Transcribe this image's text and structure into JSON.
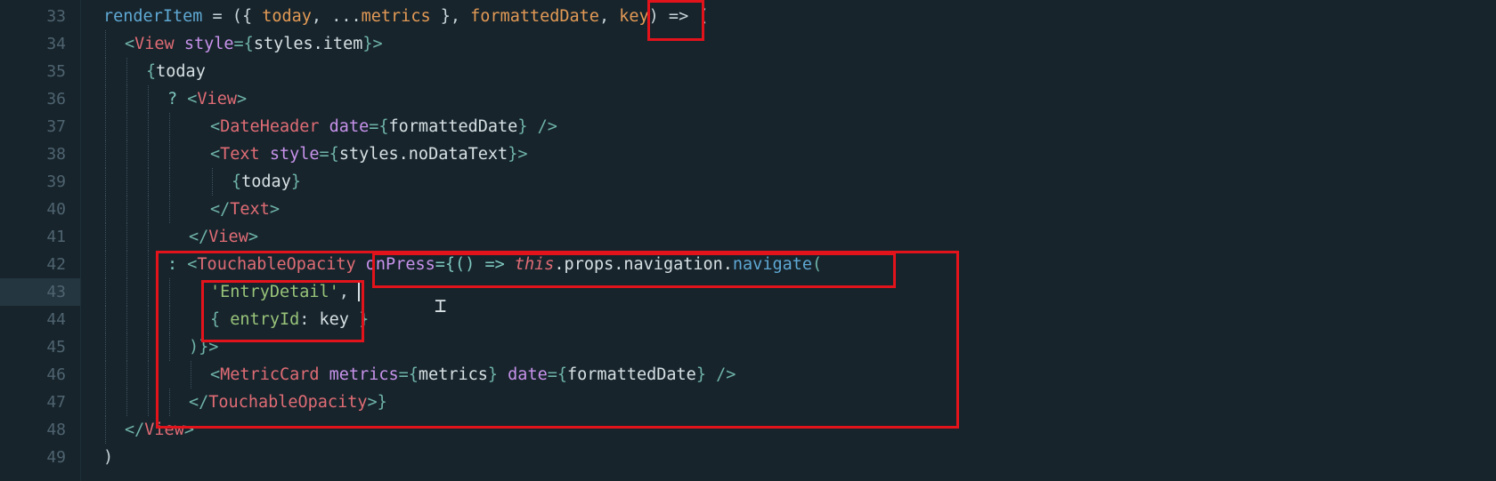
{
  "editor": {
    "lines": [
      {
        "num": "33"
      },
      {
        "num": "34"
      },
      {
        "num": "35"
      },
      {
        "num": "36"
      },
      {
        "num": "37"
      },
      {
        "num": "38"
      },
      {
        "num": "39"
      },
      {
        "num": "40"
      },
      {
        "num": "41"
      },
      {
        "num": "42"
      },
      {
        "num": "43"
      },
      {
        "num": "44"
      },
      {
        "num": "45"
      },
      {
        "num": "46"
      },
      {
        "num": "47"
      },
      {
        "num": "48"
      },
      {
        "num": "49"
      }
    ],
    "current_line": "43",
    "tokens": {
      "l33": [
        "renderItem",
        " = ({ ",
        "today",
        ", ...",
        "metrics",
        " }, ",
        "formattedDate",
        ", ",
        "key",
        ") => ("
      ],
      "l34": [
        "<",
        "View",
        " ",
        "style",
        "={",
        "styles.item",
        "}>"
      ],
      "l35": [
        "{",
        "today"
      ],
      "l36": [
        "? ",
        "<",
        "View",
        ">"
      ],
      "l37": [
        "<",
        "DateHeader",
        " ",
        "date",
        "={",
        "formattedDate",
        "} />"
      ],
      "l38": [
        "<",
        "Text",
        " ",
        "style",
        "={",
        "styles.noDataText",
        "}>"
      ],
      "l39": [
        "{",
        "today",
        "}"
      ],
      "l40": [
        "</",
        "Text",
        ">"
      ],
      "l41": [
        "</",
        "View",
        ">"
      ],
      "l42": [
        ": ",
        "<",
        "TouchableOpacity",
        " ",
        "onPress",
        "={() => ",
        "this",
        ".props.navigation.",
        "navigate",
        "("
      ],
      "l43": [
        "'EntryDetail'",
        ","
      ],
      "l44": [
        "{ ",
        "entryId",
        ": ",
        "key",
        " }"
      ],
      "l45": [
        ")",
        "}>"
      ],
      "l46": [
        "<",
        "MetricCard",
        " ",
        "metrics",
        "={",
        "metrics",
        "} ",
        "date",
        "={",
        "formattedDate",
        "} />"
      ],
      "l47": [
        "</",
        "TouchableOpacity",
        ">}"
      ],
      "l48": [
        "</",
        "View",
        ">"
      ],
      "l49": [
        ")"
      ]
    }
  },
  "colors": {
    "background": "#17242c",
    "annotation_red": "#e3131b"
  }
}
